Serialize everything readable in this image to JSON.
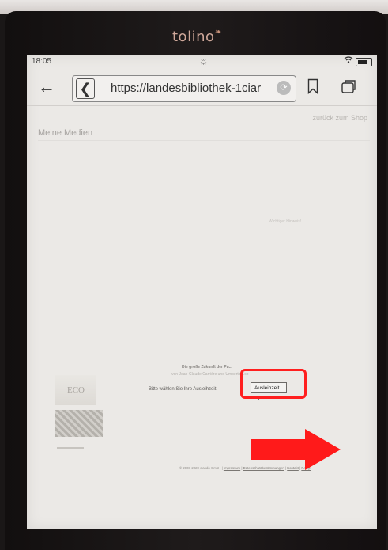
{
  "device": {
    "brand": "tolino",
    "brand_mark": "❧"
  },
  "status_bar": {
    "time": "18:05",
    "light_icon": "sun-icon",
    "wifi_icon": "wifi-icon",
    "battery_icon": "battery-icon"
  },
  "toolbar": {
    "back_icon": "←",
    "url_back_icon": "❮",
    "url": "https://landesbibliothek-1ciar",
    "reload_icon": "⟳"
  },
  "page": {
    "back_to_shop": "zurück zum Shop",
    "title": "Meine Medien",
    "notice_heading": "Wichtiger Hinweis!",
    "book": {
      "title": "Die große Zukunft der Pu...",
      "author": "von Jean-Claude Carrière und Umberto Eco",
      "cover_text": "ECO"
    },
    "choose_lending_label": "Bitte wählen Sie Ihre Ausleihzeit:",
    "lending_select": {
      "value": "Ausleihzeit",
      "caret": "▼"
    },
    "footer": {
      "copyright": "© 2008-2020 ciando GmbH |",
      "links": [
        "Impressum",
        "Datenschutzbestimmungen",
        "Kontakt",
        "F.A.Q."
      ]
    }
  },
  "annotations": {
    "highlight_color": "#ff1f1f",
    "arrow_color": "#ff1a1a"
  }
}
